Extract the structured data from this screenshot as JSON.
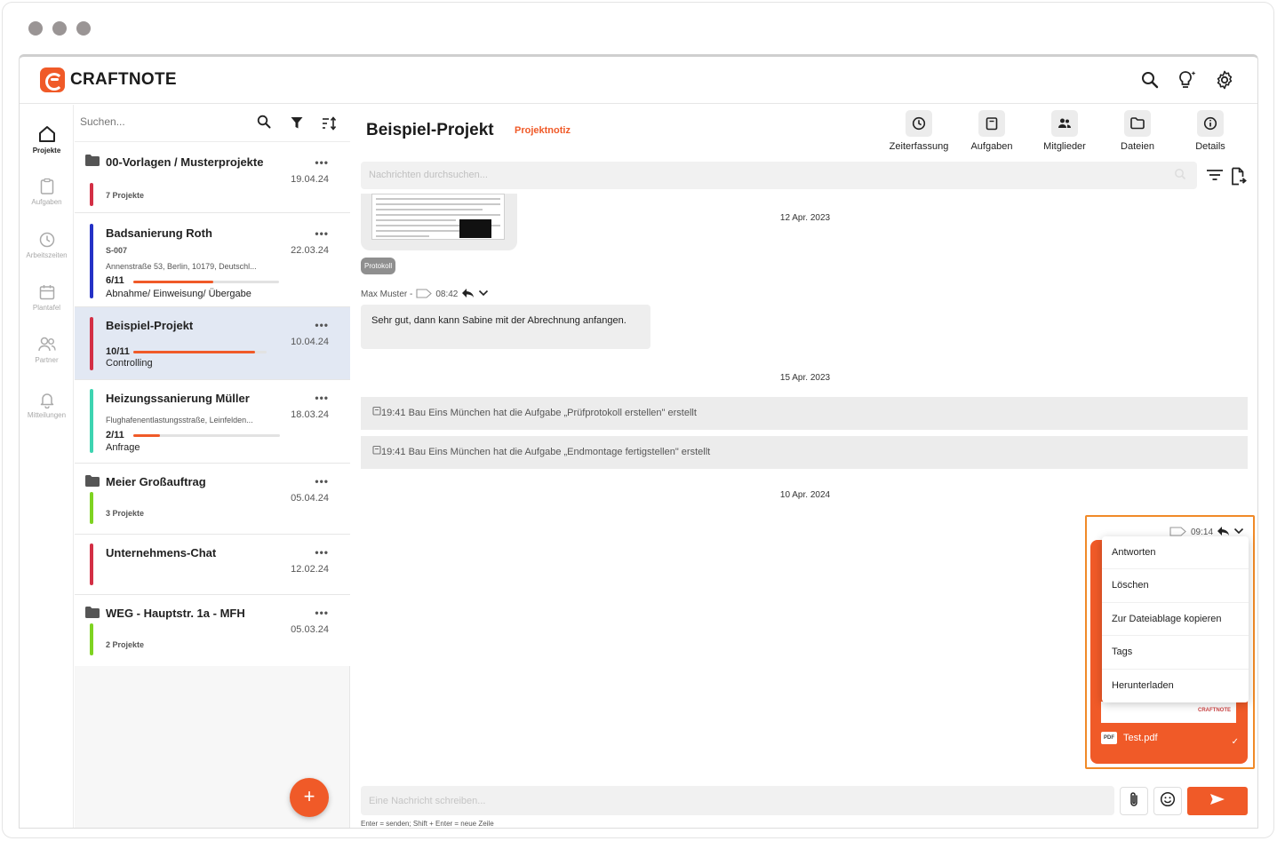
{
  "app": {
    "name": "CRAFTNOTE"
  },
  "colors": {
    "accent": "#f05a28",
    "selected": "#e2e8f3",
    "highlight_border": "#f08a28"
  },
  "top_icons": [
    "search-icon",
    "lightbulb-icon",
    "gear-icon"
  ],
  "rail": {
    "items": [
      {
        "label": "Projekte",
        "icon": "home-icon",
        "active": true
      },
      {
        "label": "Aufgaben",
        "icon": "clipboard-icon"
      },
      {
        "label": "Arbeitszeiten",
        "icon": "clock-icon"
      },
      {
        "label": "Plantafel",
        "icon": "calendar-icon"
      },
      {
        "label": "Partner",
        "icon": "people-icon"
      },
      {
        "label": "Mitteilungen",
        "icon": "bell-icon"
      }
    ]
  },
  "project_list": {
    "search_placeholder": "Suchen...",
    "items": [
      {
        "title": "00-Vorlagen / Musterprojekte",
        "date": "19.04.24",
        "sub": "7 Projekte",
        "color": "#d32f45"
      },
      {
        "title": "Badsanierung Roth",
        "date": "22.03.24",
        "sub": "S-007",
        "address": "Annenstraße 53, Berlin, 10179, Deutschl...",
        "progress": "6/11",
        "status": "Abnahme/ Einweisung/ Übergabe",
        "color": "#2431c6"
      },
      {
        "title": "Beispiel-Projekt",
        "date": "10.04.24",
        "progress": "10/11",
        "status": "Controlling",
        "color": "#d32f45"
      },
      {
        "title": "Heizungssanierung Müller",
        "date": "18.03.24",
        "address": "Flughafenentlastungsstraße, Leinfelden...",
        "progress": "2/11",
        "status": "Anfrage",
        "color": "#3ed4b1"
      },
      {
        "title": "Meier Großauftrag",
        "date": "05.04.24",
        "sub": "3 Projekte",
        "color": "#7ed321"
      },
      {
        "title": "Unternehmens-Chat",
        "date": "12.02.24",
        "color": "#d32f45"
      },
      {
        "title": "WEG - Hauptstr. 1a - MFH",
        "date": "05.03.24",
        "sub": "2 Projekte",
        "color": "#7ed321"
      }
    ],
    "progress_fractions": [
      0.55,
      0.91,
      0.18
    ],
    "dots": "•••",
    "fab_label": "+"
  },
  "project": {
    "title": "Beispiel-Projekt",
    "tag": "Projektnotiz",
    "tabs": [
      {
        "label": "Zeiterfassung",
        "icon": "clock-icon"
      },
      {
        "label": "Aufgaben",
        "icon": "clipboard-icon"
      },
      {
        "label": "Mitglieder",
        "icon": "people-icon"
      },
      {
        "label": "Dateien",
        "icon": "folder-icon"
      },
      {
        "label": "Details",
        "icon": "info-icon"
      }
    ],
    "search_placeholder": "Nachrichten durchsuchen..."
  },
  "feed": {
    "chip": "Protokoll",
    "date_1": "12 Apr. 2023",
    "msg_author": "Max Muster -",
    "msg_time": "08:42",
    "msg_text": "Sehr gut, dann kann Sabine mit der Abrechnung anfangen.",
    "date_2": "15 Apr. 2023",
    "sys_1": "19:41 Bau Eins München hat die Aufgabe „Prüfprotokoll erstellen\" erstellt",
    "sys_2": "19:41 Bau Eins München hat die Aufgabe „Endmontage fertigstellen\" erstellt",
    "date_3": "10 Apr. 2024",
    "own_time": "09:14",
    "own_file": "Test.pdf",
    "pdf_badge": "PDF",
    "mini_logo": "CRAFTNOTE",
    "check": "✓"
  },
  "context_menu": [
    "Antworten",
    "Löschen",
    "Zur Dateiablage kopieren",
    "Tags",
    "Herunterladen"
  ],
  "composer": {
    "placeholder": "Eine Nachricht schreiben...",
    "hint": "Enter = senden; Shift + Enter = neue Zeile"
  }
}
